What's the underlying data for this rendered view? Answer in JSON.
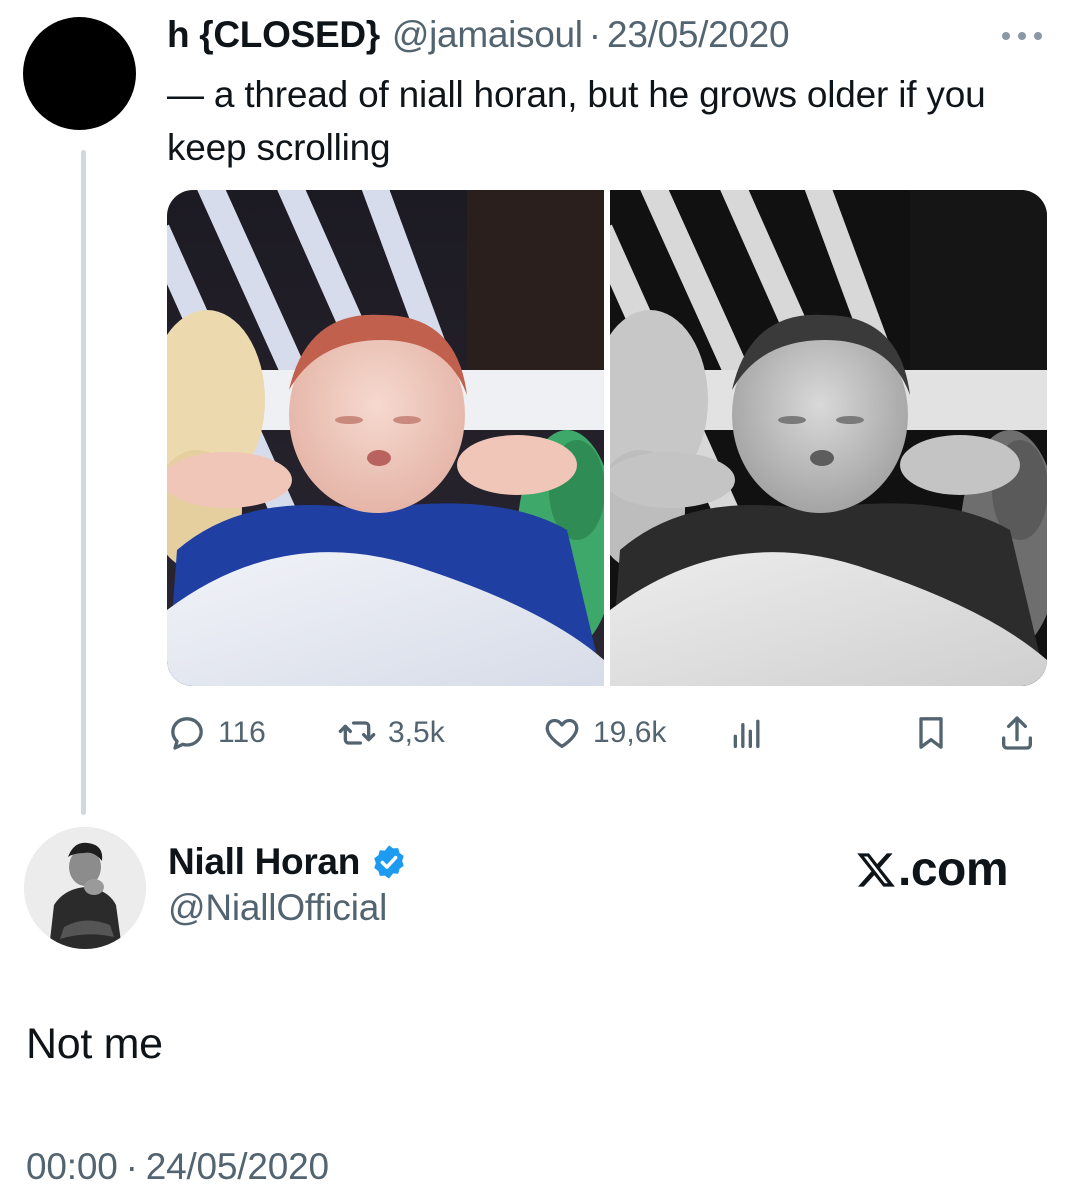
{
  "parent_tweet": {
    "display_name": "h {CLOSED}",
    "handle": "@jamaisoul",
    "separator": "·",
    "date": "23/05/2020",
    "text": "— a thread of niall horan, but he grows older if you keep scrolling",
    "media": [
      {
        "kind": "photo",
        "style": "color",
        "icon": "baby-photo-color"
      },
      {
        "kind": "photo",
        "style": "black-and-white",
        "icon": "baby-photo-bw"
      }
    ],
    "stats": {
      "replies": "116",
      "retweets": "3,5k",
      "likes": "19,6k"
    }
  },
  "main_tweet": {
    "display_name": "Niall Horan",
    "verified": true,
    "handle": "@NiallOfficial",
    "text": "Not me",
    "time": "00:00",
    "separator": "·",
    "date": "24/05/2020"
  },
  "brand": {
    "suffix": ".com",
    "logo": "x-logo-icon"
  },
  "colors": {
    "text": "#0f1419",
    "secondary": "#536471",
    "thread_line": "#cfd9de",
    "verified": "#1d9bf0"
  }
}
